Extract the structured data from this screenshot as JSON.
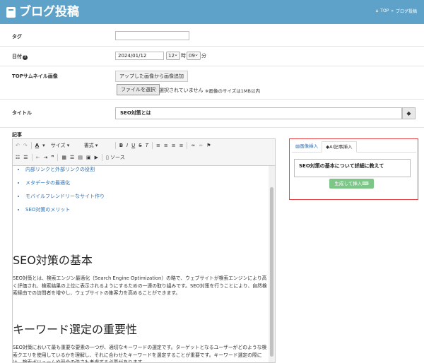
{
  "header": {
    "title": "ブログ投稿",
    "crumb_top": "TOP",
    "crumb_sep": "»",
    "crumb_current": "ブログ投稿"
  },
  "form": {
    "tag_label": "タグ",
    "date_label": "日付",
    "date_value": "2024/01/12",
    "hour_value": "12",
    "hour_unit": "時",
    "minute_value": "09",
    "minute_unit": "分",
    "thumb_label": "TOPサムネイル画像",
    "add_uploaded_btn": "アップした画像から画像追加",
    "choose_file_btn": "ファイルを選択",
    "no_file_text": "選択されていません",
    "size_note": "※画像のサイズは1MB以内",
    "title_label": "タイトル",
    "title_value": "SEO対策とは",
    "body_label": "記事"
  },
  "toolbar": {
    "size_label": "サイズ",
    "format_label": "書式",
    "source_label": "ソース"
  },
  "editor": {
    "list_items": [
      "内部リンクと外部リンクの役割",
      "メタデータの最適化",
      "モバイルフレンドリーなサイト作り",
      "SEO対策のメリット"
    ],
    "h1": "SEO対策の基本",
    "p1": "SEO対策とは、検索エンジン最適化（Search Engine Optimization）の略で、ウェブサイトが検索エンジンにより高く評価され、検索結果の上位に表示されるようにするための一連の取り組みです。SEO対策を行うことにより、自然検索経由での訪問者を増やし、ウェブサイトの集客力を高めることができます。",
    "h2": "キーワード選定の重要性",
    "p2": "SEO対策において最も重要な要素の一つが、適切なキーワードの選定です。ターゲットとなるユーザーがどのような検索クエリを使用しているかを理解し、それに合わせたキーワードを選定することが重要です。キーワード選定の際には、検索ボリュームや競合の強さも考慮する必要があります。"
  },
  "ai": {
    "tab_image": "画像挿入",
    "tab_ai": "AI記事挿入",
    "prompt": "SEO対策の基本について詳細に教えて",
    "generate_btn": "生成して挿入"
  },
  "colors": {
    "header_bg": "#5fa2c9",
    "ai_border": "#e64646",
    "generate_btn": "#7cc787",
    "link": "#2a6fb5"
  }
}
